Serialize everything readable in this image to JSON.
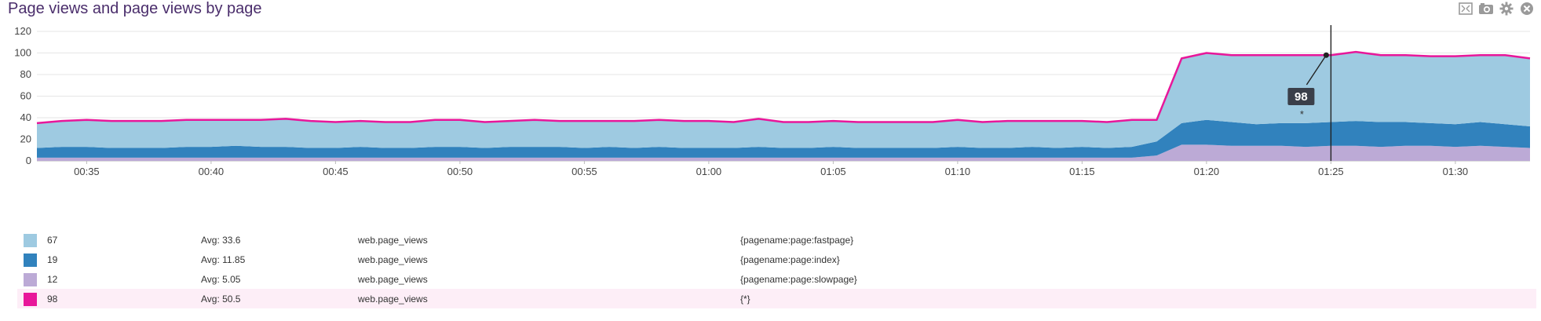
{
  "panel": {
    "title": "Page views and page views by page",
    "toolbar": [
      {
        "name": "expand-icon"
      },
      {
        "name": "camera-icon"
      },
      {
        "name": "gear-icon"
      },
      {
        "name": "close-icon"
      }
    ]
  },
  "tooltip": {
    "value": "98",
    "scope": "*"
  },
  "legend": [
    {
      "last": "67",
      "avg": "Avg: 33.6",
      "metric": "web.page_views",
      "scope": "{pagename:page:fastpage}",
      "color": "#9ecae1"
    },
    {
      "last": "19",
      "avg": "Avg: 11.85",
      "metric": "web.page_views",
      "scope": "{pagename:page:index}",
      "color": "#3182bd"
    },
    {
      "last": "12",
      "avg": "Avg: 5.05",
      "metric": "web.page_views",
      "scope": "{pagename:page:slowpage}",
      "color": "#bcaad6"
    },
    {
      "last": "98",
      "avg": "Avg: 50.5",
      "metric": "web.page_views",
      "scope": "{*}",
      "color": "#e8179a"
    }
  ],
  "chart_data": {
    "type": "area",
    "stacked": true,
    "xlabel": "",
    "ylabel": "",
    "ylim": [
      0,
      120
    ],
    "y_ticks": [
      0,
      20,
      40,
      60,
      80,
      100,
      120
    ],
    "x_ticks": [
      "00:35",
      "00:40",
      "00:45",
      "00:50",
      "00:55",
      "01:00",
      "01:05",
      "01:10",
      "01:15",
      "01:20",
      "01:25",
      "01:30"
    ],
    "time_start": "00:33",
    "time_end": "01:33",
    "grid": true,
    "hover_time": "01:25",
    "colors": {
      "slowpage": "#bcaad6",
      "index": "#3182bd",
      "fastpage": "#9ecae1",
      "total": "#e8179a"
    },
    "x": [
      "00:33",
      "00:34",
      "00:35",
      "00:36",
      "00:37",
      "00:38",
      "00:39",
      "00:40",
      "00:41",
      "00:42",
      "00:43",
      "00:44",
      "00:45",
      "00:46",
      "00:47",
      "00:48",
      "00:49",
      "00:50",
      "00:51",
      "00:52",
      "00:53",
      "00:54",
      "00:55",
      "00:56",
      "00:57",
      "00:58",
      "00:59",
      "01:00",
      "01:01",
      "01:02",
      "01:03",
      "01:04",
      "01:05",
      "01:06",
      "01:07",
      "01:08",
      "01:09",
      "01:10",
      "01:11",
      "01:12",
      "01:13",
      "01:14",
      "01:15",
      "01:16",
      "01:17",
      "01:18",
      "01:19",
      "01:20",
      "01:21",
      "01:22",
      "01:23",
      "01:24",
      "01:25",
      "01:26",
      "01:27",
      "01:28",
      "01:29",
      "01:30",
      "01:31",
      "01:32",
      "01:33"
    ],
    "series": [
      {
        "name": "{pagename:page:slowpage}",
        "values": [
          3,
          3,
          3,
          3,
          3,
          3,
          3,
          3,
          3,
          3,
          3,
          3,
          3,
          3,
          3,
          3,
          3,
          3,
          3,
          3,
          3,
          3,
          3,
          3,
          3,
          3,
          3,
          3,
          3,
          3,
          3,
          3,
          3,
          3,
          3,
          3,
          3,
          3,
          3,
          3,
          3,
          3,
          3,
          3,
          3,
          5,
          15,
          15,
          14,
          14,
          14,
          13,
          14,
          14,
          13,
          14,
          14,
          13,
          14,
          13,
          12
        ]
      },
      {
        "name": "{pagename:page:index}",
        "values": [
          9,
          10,
          10,
          9,
          9,
          9,
          10,
          10,
          11,
          10,
          10,
          9,
          9,
          10,
          9,
          9,
          10,
          10,
          9,
          10,
          10,
          10,
          9,
          10,
          9,
          10,
          9,
          9,
          9,
          10,
          9,
          9,
          10,
          9,
          9,
          9,
          9,
          10,
          9,
          9,
          10,
          9,
          10,
          9,
          10,
          13,
          20,
          23,
          22,
          20,
          21,
          22,
          22,
          23,
          23,
          22,
          21,
          21,
          22,
          21,
          20
        ]
      },
      {
        "name": "{pagename:page:fastpage}",
        "values": [
          23,
          24,
          25,
          25,
          25,
          25,
          25,
          25,
          24,
          25,
          26,
          25,
          24,
          24,
          24,
          24,
          25,
          25,
          24,
          24,
          25,
          24,
          25,
          24,
          25,
          25,
          25,
          25,
          24,
          26,
          24,
          24,
          24,
          24,
          24,
          24,
          24,
          25,
          24,
          25,
          24,
          25,
          24,
          24,
          25,
          20,
          60,
          62,
          62,
          64,
          63,
          63,
          62,
          64,
          62,
          62,
          62,
          63,
          62,
          64,
          63
        ]
      },
      {
        "name": "{*}",
        "values": [
          35,
          37,
          38,
          37,
          37,
          37,
          38,
          38,
          38,
          38,
          39,
          37,
          36,
          37,
          36,
          36,
          38,
          38,
          36,
          37,
          38,
          37,
          37,
          37,
          37,
          38,
          37,
          37,
          36,
          39,
          36,
          36,
          37,
          36,
          36,
          36,
          36,
          38,
          36,
          37,
          37,
          37,
          37,
          36,
          38,
          38,
          95,
          100,
          98,
          98,
          98,
          98,
          98,
          101,
          98,
          98,
          97,
          97,
          98,
          98,
          95
        ]
      }
    ]
  }
}
